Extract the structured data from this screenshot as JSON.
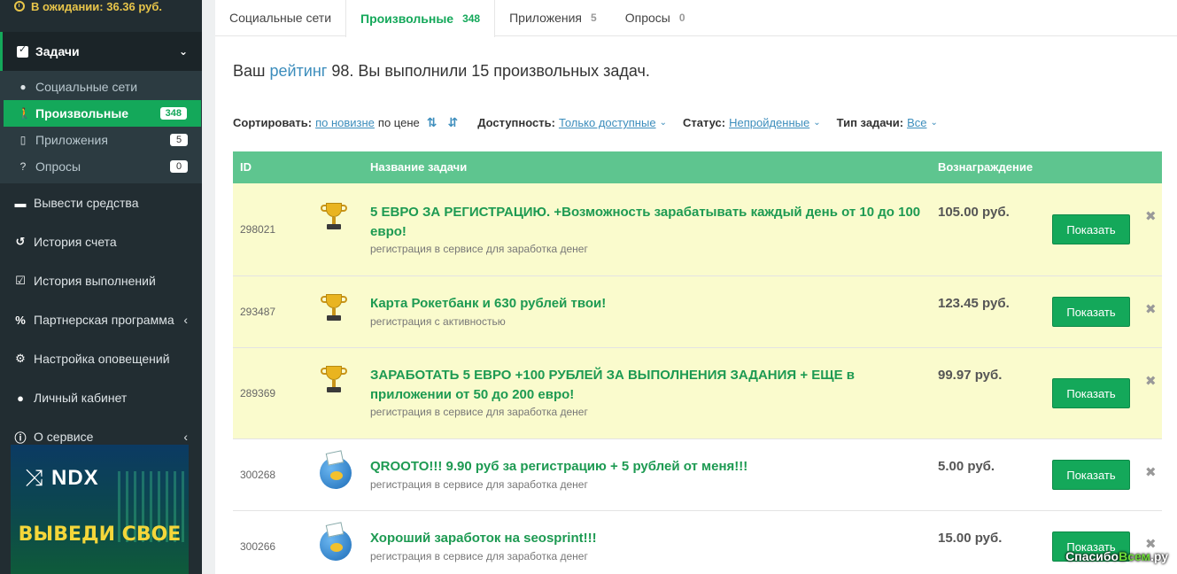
{
  "sidebar": {
    "pending": "В ожидании: 36.36 руб.",
    "tasks_label": "Задачи",
    "subitems": [
      {
        "label": "Социальные сети",
        "icon": "users-icon",
        "badge": ""
      },
      {
        "label": "Произвольные",
        "icon": "walker-icon",
        "badge": "348"
      },
      {
        "label": "Приложения",
        "icon": "phone-icon",
        "badge": "5"
      },
      {
        "label": "Опросы",
        "icon": "question-icon",
        "badge": "0"
      }
    ],
    "items": [
      {
        "label": "Вывести средства",
        "icon": "minus-square-icon"
      },
      {
        "label": "История счета",
        "icon": "history-icon"
      },
      {
        "label": "История выполнений",
        "icon": "checklist-icon"
      },
      {
        "label": "Партнерская программа",
        "icon": "percent-icon"
      },
      {
        "label": "Настройка оповещений",
        "icon": "gear-icon"
      },
      {
        "label": "Личный кабинет",
        "icon": "user-icon"
      },
      {
        "label": "О сервисе",
        "icon": "info-icon"
      }
    ],
    "banner": {
      "logo": "NDX",
      "cta": "ВЫВЕДИ СВОЕ"
    }
  },
  "tabs": [
    {
      "label": "Социальные сети",
      "count": ""
    },
    {
      "label": "Произвольные",
      "count": "348"
    },
    {
      "label": "Приложения",
      "count": "5"
    },
    {
      "label": "Опросы",
      "count": "0"
    }
  ],
  "rating": {
    "prefix": "Ваш ",
    "link": "рейтинг",
    "suffix": " 98. Вы выполнили 15 произвольных задач."
  },
  "filters": {
    "sort_label": "Сортировать:",
    "sort_new": "по новизне",
    "sort_price": "по цене",
    "availability_label": "Доступность:",
    "availability_value": "Только доступные",
    "status_label": "Статус:",
    "status_value": "Непройденные",
    "type_label": "Тип задачи:",
    "type_value": "Все"
  },
  "table": {
    "headers": {
      "id": "ID",
      "name": "Название задачи",
      "reward": "Вознаграждение"
    },
    "button_label": "Показать",
    "rows": [
      {
        "id": "298021",
        "title": "5 ЕВРО ЗА РЕГИСТРАЦИЮ. +Возможность зарабатывать каждый день от 10 до 100 евро!",
        "desc": "регистрация в сервисе для заработка денег",
        "reward": "105.00 руб.",
        "icon": "trophy-icon",
        "highlight": true
      },
      {
        "id": "293487",
        "title": "Карта Рокетбанк и 630 рублей твои!",
        "desc": "регистрация с активностью",
        "reward": "123.45 руб.",
        "icon": "trophy-icon",
        "highlight": true
      },
      {
        "id": "289369",
        "title": "ЗАРАБОТАТЬ 5 ЕВРО +100 РУБЛЕЙ ЗА ВЫПОЛНЕНИЯ ЗАДАНИЯ + ЕЩЕ в приложении от 50 до 200 евро!",
        "desc": "регистрация в сервисе для заработка денег",
        "reward": "99.97 руб.",
        "icon": "trophy-icon",
        "highlight": true
      },
      {
        "id": "300268",
        "title": "QROOTO!!! 9.90 руб за регистрацию + 5 рублей от меня!!!",
        "desc": "регистрация в сервисе для заработка денег",
        "reward": "5.00 руб.",
        "icon": "globe-icon",
        "highlight": false
      },
      {
        "id": "300266",
        "title": "Хороший заработок на seosprint!!!",
        "desc": "регистрация в сервисе для заработка денег",
        "reward": "15.00 руб.",
        "icon": "globe-icon",
        "highlight": false
      }
    ]
  },
  "watermark": {
    "left": "Спасибо",
    "brand": "Всем",
    "right": ".ру"
  }
}
